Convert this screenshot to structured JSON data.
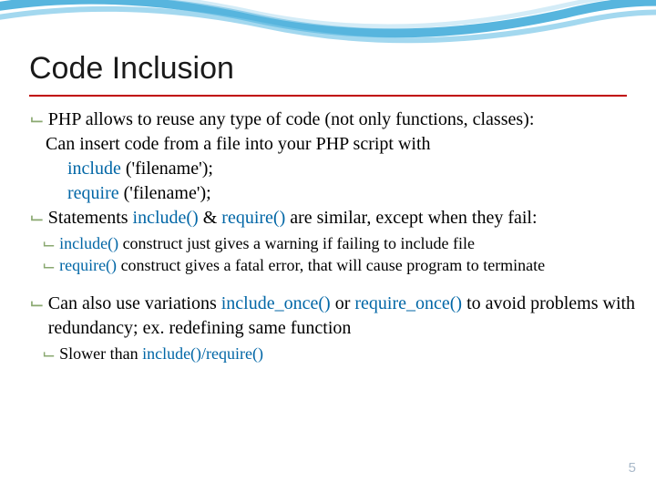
{
  "title": "Code Inclusion",
  "bullets": {
    "b1": "PHP allows to reuse any type of code (not only functions, classes):",
    "b1_line2": "Can insert code from a file into your PHP script with",
    "b1_code1_kw": "include",
    "b1_code1_rest": " ('filename');",
    "b1_code2_kw": "require",
    "b1_code2_rest": " ('filename');",
    "b2_pre": "Statements ",
    "b2_kw1": "include()",
    "b2_mid": " & ",
    "b2_kw2": "require()",
    "b2_post": " are similar, except when they fail:",
    "b2_sub1_kw": "include()",
    "b2_sub1_rest": " construct just gives a warning if failing to include file",
    "b2_sub2_kw": "require()",
    "b2_sub2_rest": " construct gives a fatal error, that will cause program to terminate",
    "b3_pre": "Can also use variations ",
    "b3_kw1": "include_once()",
    "b3_mid": " or ",
    "b3_kw2": "require_once()",
    "b3_post": " to avoid problems with redundancy; ex. redefining same function",
    "b3_sub1_pre": "Slower than ",
    "b3_sub1_kw": "include()/require()"
  },
  "page_number": "5"
}
